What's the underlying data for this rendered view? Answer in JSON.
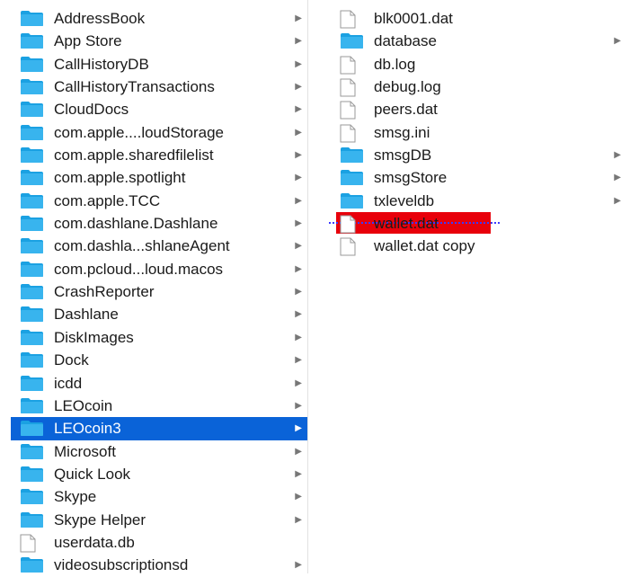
{
  "colors": {
    "selection": "#0a63d8",
    "drag_highlight": "#e8000b",
    "drop_indicator": "#3a3aff",
    "folder_icon": "#1ba1e2"
  },
  "column1": {
    "items": [
      {
        "label": "AddressBook",
        "icon": "folder-icon",
        "chevron": true
      },
      {
        "label": "App Store",
        "icon": "folder-icon",
        "chevron": true
      },
      {
        "label": "CallHistoryDB",
        "icon": "folder-icon",
        "chevron": true
      },
      {
        "label": "CallHistoryTransactions",
        "icon": "folder-icon",
        "chevron": true
      },
      {
        "label": "CloudDocs",
        "icon": "folder-icon",
        "chevron": true
      },
      {
        "label": "com.apple....loudStorage",
        "icon": "folder-icon",
        "chevron": true
      },
      {
        "label": "com.apple.sharedfilelist",
        "icon": "folder-icon",
        "chevron": true
      },
      {
        "label": "com.apple.spotlight",
        "icon": "folder-icon",
        "chevron": true
      },
      {
        "label": "com.apple.TCC",
        "icon": "folder-icon",
        "chevron": true
      },
      {
        "label": "com.dashlane.Dashlane",
        "icon": "folder-icon",
        "chevron": true
      },
      {
        "label": "com.dashla...shlaneAgent",
        "icon": "folder-icon",
        "chevron": true
      },
      {
        "label": "com.pcloud...loud.macos",
        "icon": "folder-icon",
        "chevron": true
      },
      {
        "label": "CrashReporter",
        "icon": "folder-icon",
        "chevron": true
      },
      {
        "label": "Dashlane",
        "icon": "folder-icon",
        "chevron": true
      },
      {
        "label": "DiskImages",
        "icon": "folder-icon",
        "chevron": true
      },
      {
        "label": "Dock",
        "icon": "folder-icon",
        "chevron": true
      },
      {
        "label": "icdd",
        "icon": "folder-icon",
        "chevron": true
      },
      {
        "label": "LEOcoin",
        "icon": "folder-icon",
        "chevron": true
      },
      {
        "label": "LEOcoin3",
        "icon": "folder-icon",
        "chevron": true,
        "selected": true
      },
      {
        "label": "Microsoft",
        "icon": "folder-icon",
        "chevron": true
      },
      {
        "label": "Quick Look",
        "icon": "folder-icon",
        "chevron": true
      },
      {
        "label": "Skype",
        "icon": "folder-icon",
        "chevron": true
      },
      {
        "label": "Skype Helper",
        "icon": "folder-icon",
        "chevron": true
      },
      {
        "label": "userdata.db",
        "icon": "file-icon",
        "chevron": false
      },
      {
        "label": "videosubscriptionsd",
        "icon": "folder-icon",
        "chevron": true
      }
    ]
  },
  "column2": {
    "items": [
      {
        "label": "blk0001.dat",
        "icon": "file-icon",
        "chevron": false
      },
      {
        "label": "database",
        "icon": "folder-icon",
        "chevron": true
      },
      {
        "label": "db.log",
        "icon": "file-icon",
        "chevron": false
      },
      {
        "label": "debug.log",
        "icon": "file-icon",
        "chevron": false
      },
      {
        "label": "peers.dat",
        "icon": "file-icon",
        "chevron": false
      },
      {
        "label": "smsg.ini",
        "icon": "file-icon",
        "chevron": false
      },
      {
        "label": "smsgDB",
        "icon": "folder-icon",
        "chevron": true
      },
      {
        "label": "smsgStore",
        "icon": "folder-icon",
        "chevron": true
      },
      {
        "label": "txleveldb",
        "icon": "folder-icon",
        "chevron": true
      },
      {
        "label": "wallet.dat",
        "icon": "file-icon",
        "chevron": false,
        "dragging": true
      },
      {
        "label": "wallet.dat copy",
        "icon": "file-icon",
        "chevron": false
      }
    ]
  },
  "chevron_glyph": "▶"
}
